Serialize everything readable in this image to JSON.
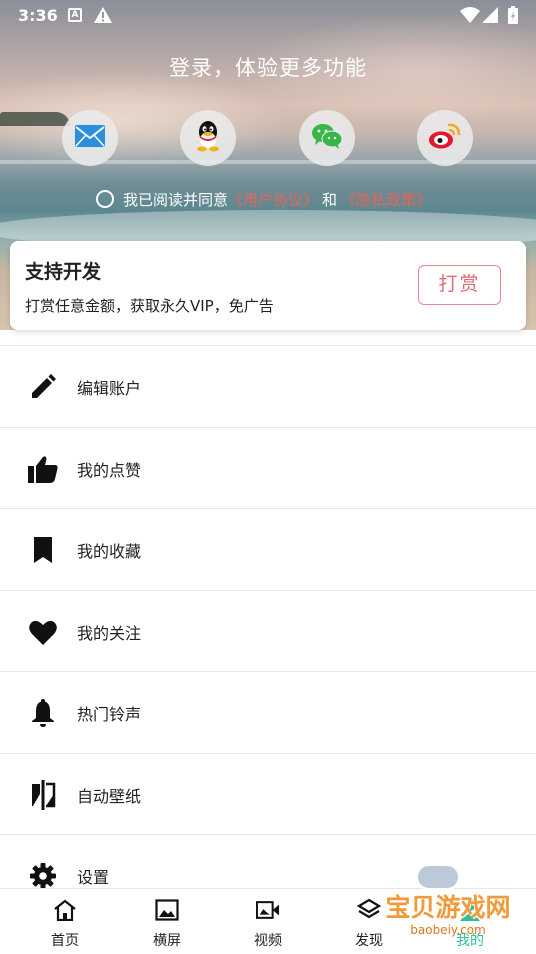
{
  "status_bar": {
    "time": "3:36",
    "icons": [
      "a-icon",
      "warning-icon",
      "wifi-icon",
      "signal-icon",
      "battery-icon"
    ]
  },
  "login": {
    "title": "登录，体验更多功能",
    "methods": [
      "email-icon",
      "qq-icon",
      "wechat-icon",
      "weibo-icon"
    ],
    "agreement": {
      "prefix": "我已阅读并同意",
      "user_agreement": "《用户协议》",
      "and": "和",
      "privacy_policy": "《隐私政策》"
    }
  },
  "support": {
    "title": "支持开发",
    "subtitle": "打赏任意金额，获取永久VIP，免广告",
    "button": "打赏"
  },
  "menu": {
    "items": [
      {
        "label": "编辑账户",
        "icon": "pencil-icon"
      },
      {
        "label": "我的点赞",
        "icon": "thumbs-up-icon"
      },
      {
        "label": "我的收藏",
        "icon": "bookmark-icon"
      },
      {
        "label": "我的关注",
        "icon": "heart-icon"
      },
      {
        "label": "热门铃声",
        "icon": "bell-icon"
      },
      {
        "label": "自动壁纸",
        "icon": "wallpaper-switch-icon"
      },
      {
        "label": "设置",
        "icon": "gear-icon"
      }
    ]
  },
  "bottom_nav": {
    "items": [
      {
        "label": "首页",
        "icon": "home-icon"
      },
      {
        "label": "横屏",
        "icon": "image-icon"
      },
      {
        "label": "视频",
        "icon": "video-icon"
      },
      {
        "label": "发现",
        "icon": "layers-icon"
      },
      {
        "label": "我的",
        "icon": "profile-icon"
      }
    ],
    "active_index": 4,
    "active_color": "#2fbf9a"
  },
  "watermark": {
    "text": "宝贝游戏网",
    "url": "baobeiy.com"
  },
  "colors": {
    "link": "#e8645a",
    "tip_button": "#e06a76"
  }
}
